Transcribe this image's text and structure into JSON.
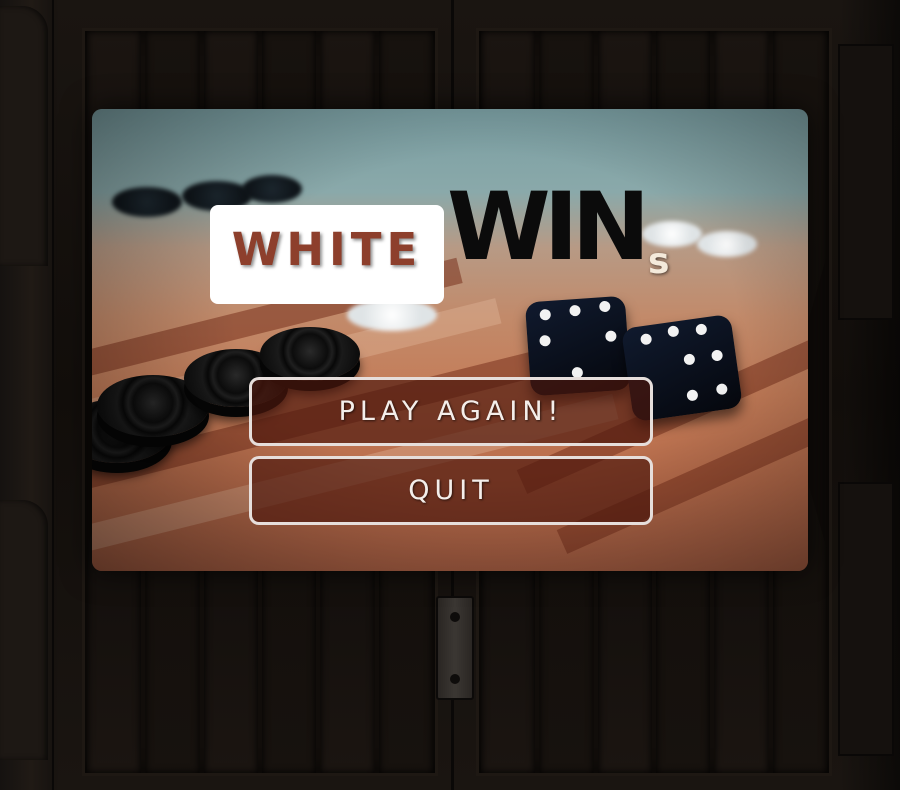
{
  "title": {
    "winner": "WHITE",
    "wins_big": "WIN",
    "wins_suffix": "s"
  },
  "buttons": {
    "play_again": "PLAY AGAIN!",
    "quit": "QUIT"
  },
  "colors": {
    "winner_text": "#8d3f2c",
    "button_fill": "#4c180e",
    "button_border": "#e6dedb",
    "board": "#120e0b"
  }
}
